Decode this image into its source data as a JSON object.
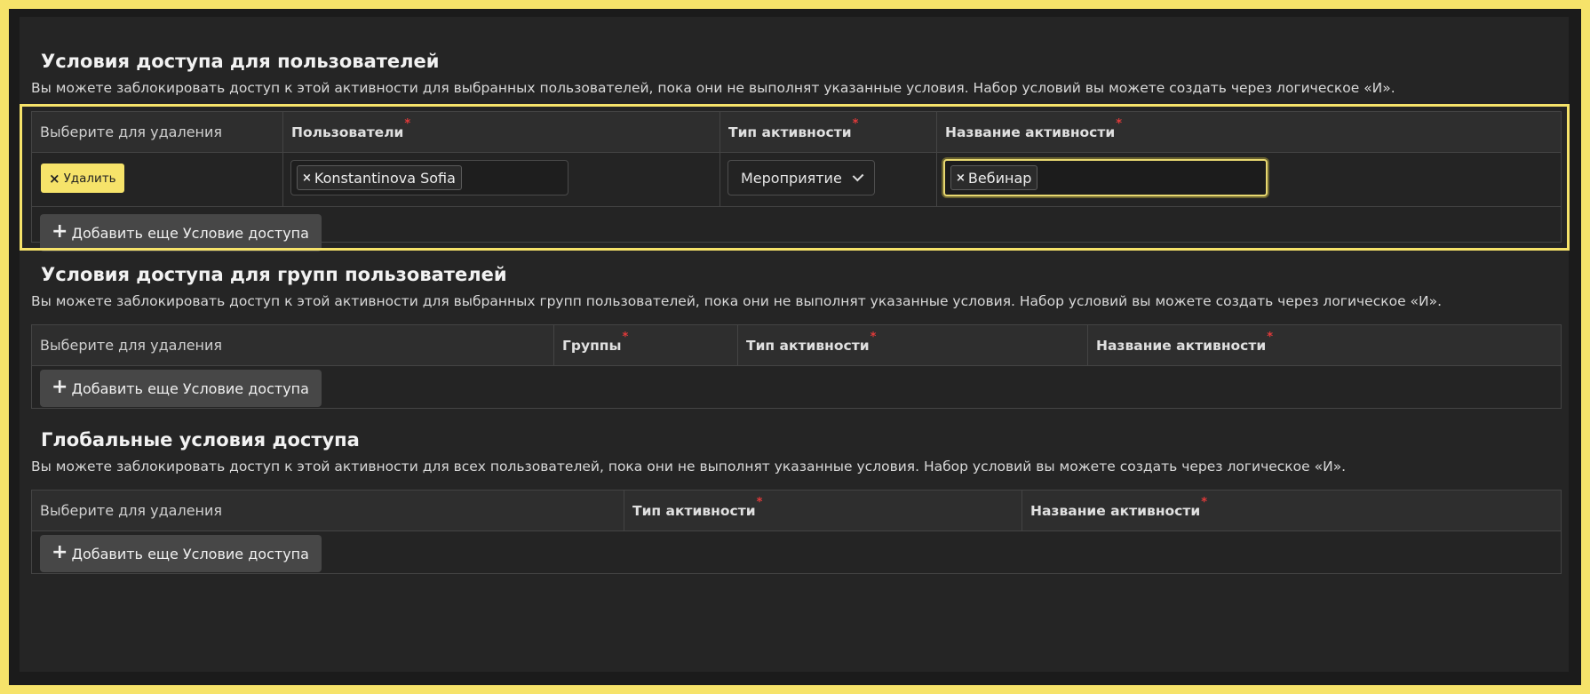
{
  "sections": {
    "users": {
      "title": "Условия доступа для пользователей",
      "description": "Вы можете заблокировать доступ к этой активности для выбранных пользователей, пока они не выполнят указанные условия. Набор условий вы можете создать через логическое «И».",
      "columns": [
        "Выберите для удаления",
        "Пользователи",
        "Тип активности",
        "Название активности"
      ],
      "required_mark": "*",
      "row": {
        "delete_label": "Удалить",
        "delete_icon": "×",
        "users_tag": "Konstantinova Sofia",
        "activity_type": "Мероприятие",
        "activity_name_tag": "Вебинар",
        "tag_remove": "×"
      },
      "add_button": "Добавить еще Условие доступа"
    },
    "groups": {
      "title": "Условия доступа для групп пользователей",
      "description": "Вы можете заблокировать доступ к этой активности для выбранных групп пользователей, пока они не выполнят указанные условия. Набор условий вы можете создать через логическое «И».",
      "columns": [
        "Выберите для удаления",
        "Группы",
        "Тип активности",
        "Название активности"
      ],
      "add_button": "Добавить еще Условие доступа"
    },
    "global": {
      "title": "Глобальные условия доступа",
      "description": "Вы можете заблокировать доступ к этой активности для всех пользователей, пока они не выполнят указанные условия. Набор условий вы можете создать через логическое «И».",
      "columns": [
        "Выберите для удаления",
        "Тип активности",
        "Название активности"
      ],
      "add_button": "Добавить еще Условие доступа"
    }
  },
  "icons": {
    "add": "plus-icon",
    "remove": "close-icon",
    "dropdown": "chevron-down-icon"
  },
  "colors": {
    "accent": "#f6e36a",
    "required": "#e23a3a",
    "background": "#252525"
  }
}
